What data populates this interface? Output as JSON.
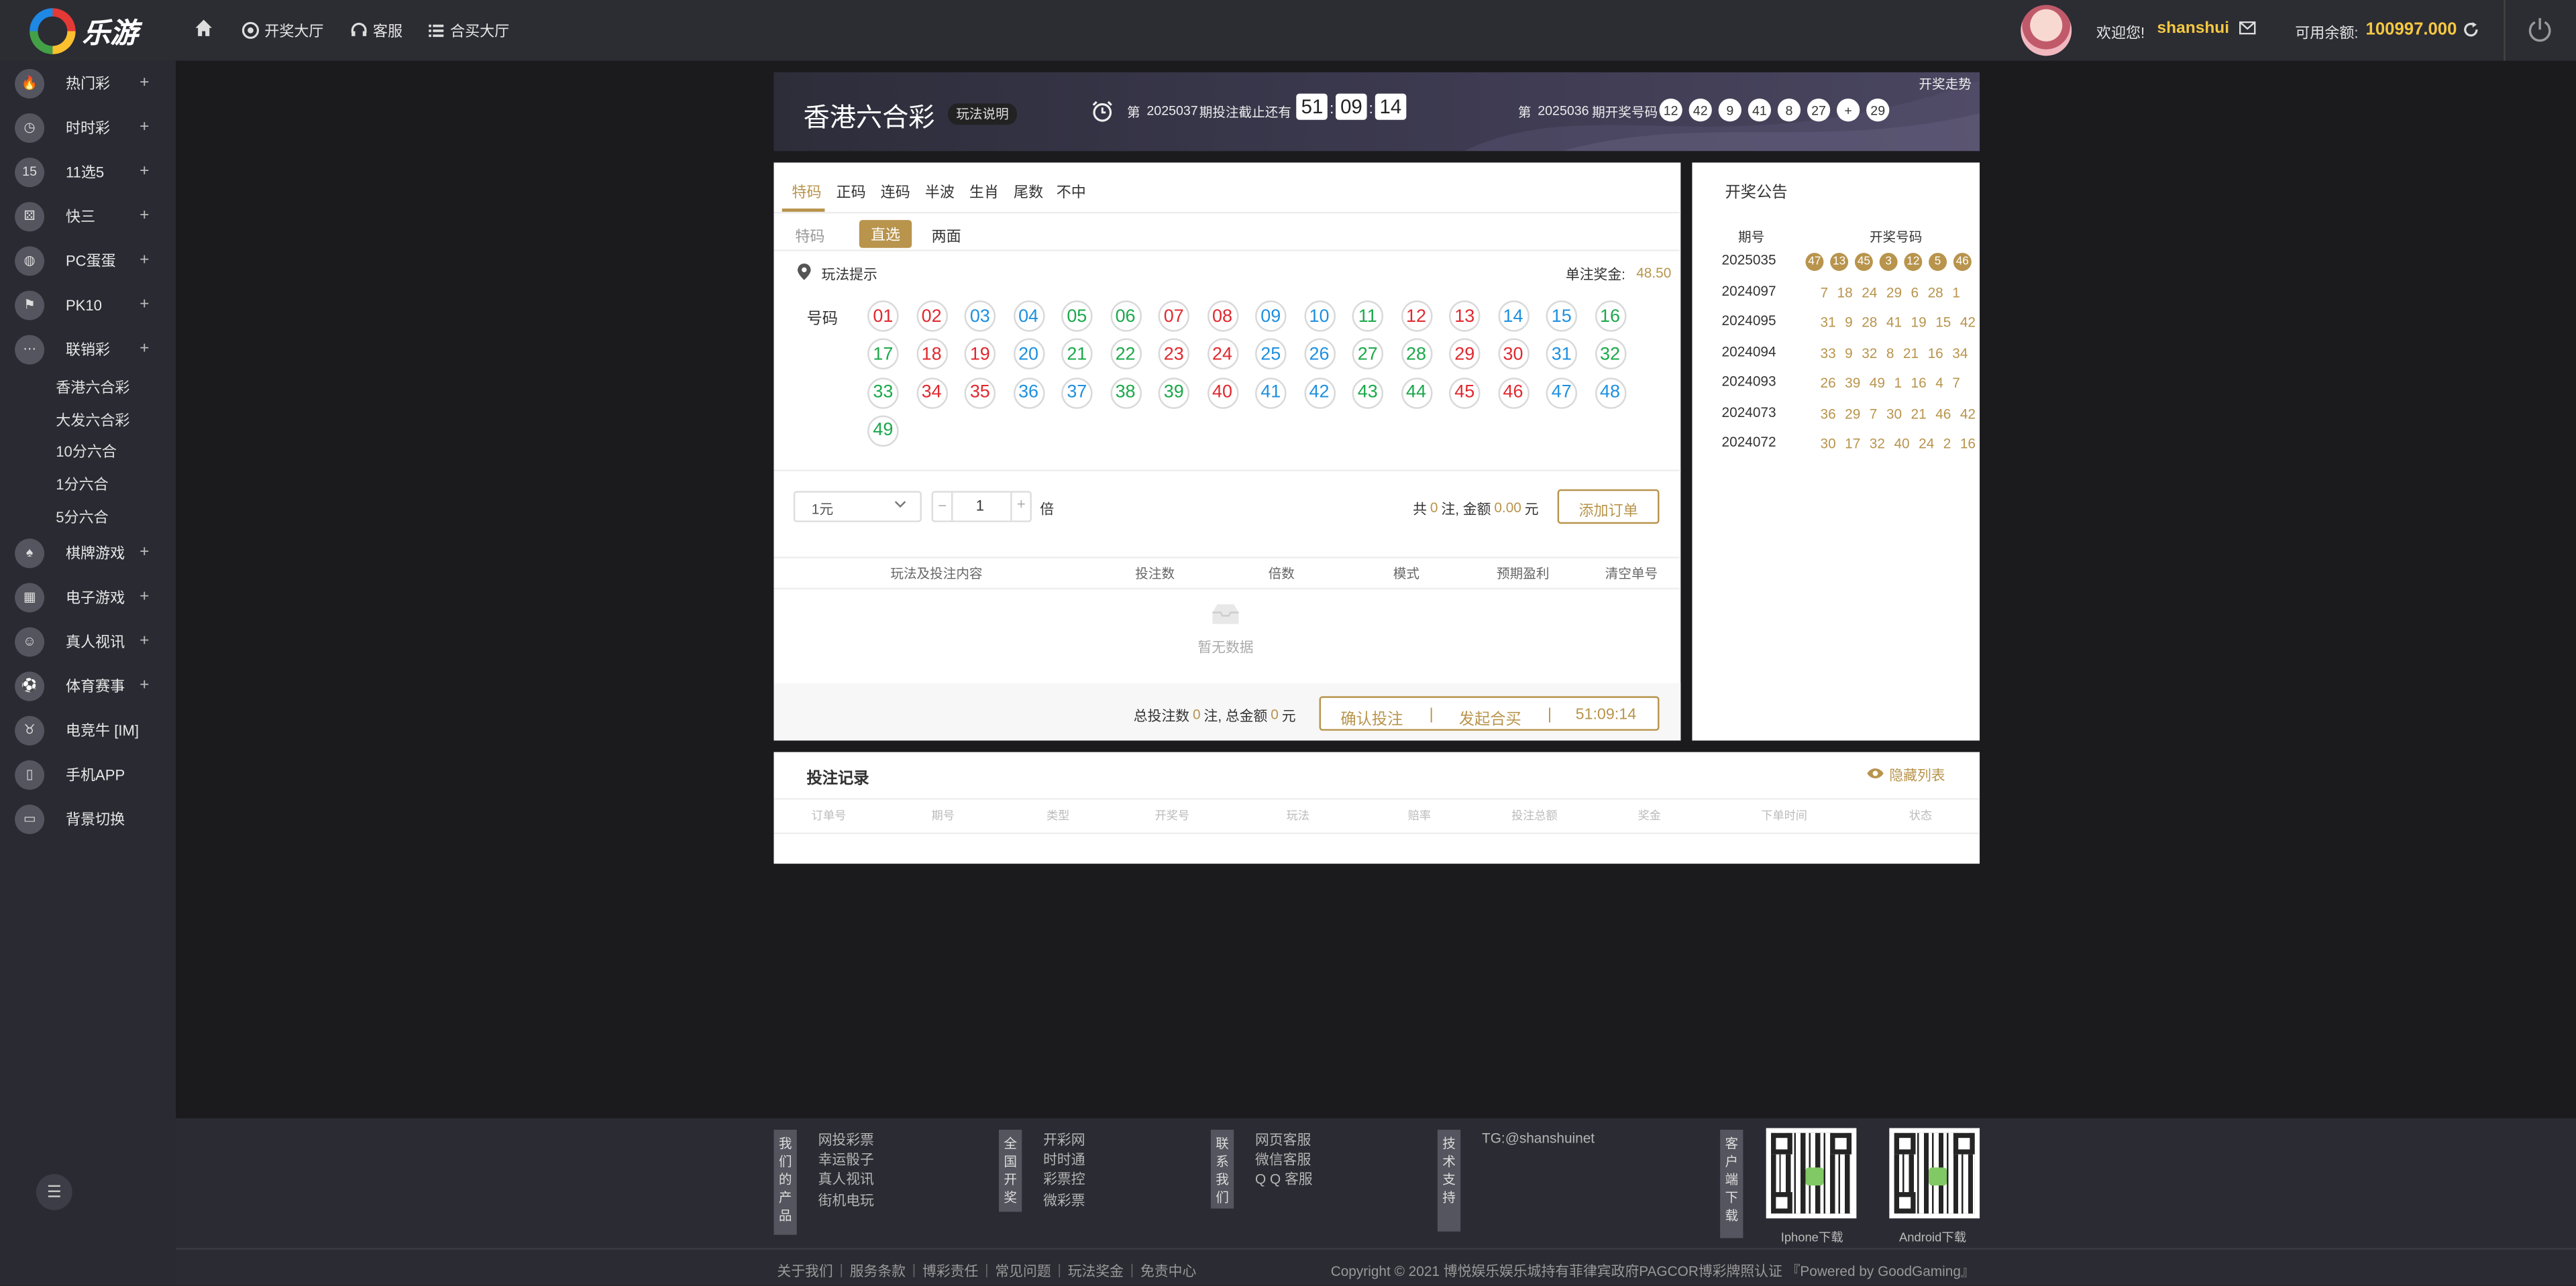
{
  "topbar": {
    "logo_text": "乐游",
    "nav": [
      {
        "label": "开奖大厅",
        "icon": "award-icon"
      },
      {
        "label": "客服",
        "icon": "headset-icon"
      },
      {
        "label": "合买大厅",
        "icon": "list-icon"
      }
    ],
    "welcome": "欢迎您!",
    "username": "shanshui",
    "balance_label": "可用余额:",
    "balance": "100997.000"
  },
  "sidebar": {
    "items": [
      {
        "label": "热门彩",
        "icon": "fire-icon"
      },
      {
        "label": "时时彩",
        "icon": "clock-icon"
      },
      {
        "label": "11选5",
        "icon": "eleven-five-icon"
      },
      {
        "label": "快三",
        "icon": "dice-icon"
      },
      {
        "label": "PC蛋蛋",
        "icon": "egg-icon"
      },
      {
        "label": "PK10",
        "icon": "race-icon"
      },
      {
        "label": "联销彩",
        "icon": "more-icon"
      }
    ],
    "subitems": [
      "香港六合彩",
      "大发六合彩",
      "10分六合",
      "1分六合",
      "5分六合"
    ],
    "items2": [
      {
        "label": "棋牌游戏",
        "icon": "cards-icon",
        "plus": true
      },
      {
        "label": "电子游戏",
        "icon": "slot-icon",
        "plus": true
      },
      {
        "label": "真人视讯",
        "icon": "dealer-icon",
        "plus": true
      },
      {
        "label": "体育赛事",
        "icon": "ball-icon",
        "plus": true
      },
      {
        "label": "电竞牛 [IM]",
        "icon": "bull-icon",
        "plus": false
      },
      {
        "label": "手机APP",
        "icon": "phone-icon",
        "plus": false
      },
      {
        "label": "背景切换",
        "icon": "monitor-icon",
        "plus": false
      }
    ]
  },
  "banner": {
    "title": "香港六合彩",
    "rules_btn": "玩法说明",
    "trend_link": "开奖走势",
    "cur_prefix": "第",
    "cur_period": "2025037",
    "cur_suffix": "期投注截止还有",
    "timer": [
      "51",
      "09",
      "14"
    ],
    "last_prefix": "第",
    "last_period": "2025036",
    "last_suffix": "期开奖号码",
    "last_numbers": [
      "12",
      "42",
      "9",
      "41",
      "8",
      "27",
      "+",
      "29"
    ]
  },
  "bet": {
    "tabs": [
      "特码",
      "正码",
      "连码",
      "半波",
      "生肖",
      "尾数",
      "不中"
    ],
    "subtabs": [
      "特码",
      "直选",
      "两面"
    ],
    "hint": "玩法提示",
    "prize_label": "单注奖金:",
    "prize": "48.50",
    "number_label": "号码",
    "numbers": [
      {
        "n": "01",
        "c": "red"
      },
      {
        "n": "02",
        "c": "red"
      },
      {
        "n": "03",
        "c": "blue"
      },
      {
        "n": "04",
        "c": "blue"
      },
      {
        "n": "05",
        "c": "green"
      },
      {
        "n": "06",
        "c": "green"
      },
      {
        "n": "07",
        "c": "red"
      },
      {
        "n": "08",
        "c": "red"
      },
      {
        "n": "09",
        "c": "blue"
      },
      {
        "n": "10",
        "c": "blue"
      },
      {
        "n": "11",
        "c": "green"
      },
      {
        "n": "12",
        "c": "red"
      },
      {
        "n": "13",
        "c": "red"
      },
      {
        "n": "14",
        "c": "blue"
      },
      {
        "n": "15",
        "c": "blue"
      },
      {
        "n": "16",
        "c": "green"
      },
      {
        "n": "17",
        "c": "green"
      },
      {
        "n": "18",
        "c": "red"
      },
      {
        "n": "19",
        "c": "red"
      },
      {
        "n": "20",
        "c": "blue"
      },
      {
        "n": "21",
        "c": "green"
      },
      {
        "n": "22",
        "c": "green"
      },
      {
        "n": "23",
        "c": "red"
      },
      {
        "n": "24",
        "c": "red"
      },
      {
        "n": "25",
        "c": "blue"
      },
      {
        "n": "26",
        "c": "blue"
      },
      {
        "n": "27",
        "c": "green"
      },
      {
        "n": "28",
        "c": "green"
      },
      {
        "n": "29",
        "c": "red"
      },
      {
        "n": "30",
        "c": "red"
      },
      {
        "n": "31",
        "c": "blue"
      },
      {
        "n": "32",
        "c": "green"
      },
      {
        "n": "33",
        "c": "green"
      },
      {
        "n": "34",
        "c": "red"
      },
      {
        "n": "35",
        "c": "red"
      },
      {
        "n": "36",
        "c": "blue"
      },
      {
        "n": "37",
        "c": "blue"
      },
      {
        "n": "38",
        "c": "green"
      },
      {
        "n": "39",
        "c": "green"
      },
      {
        "n": "40",
        "c": "red"
      },
      {
        "n": "41",
        "c": "blue"
      },
      {
        "n": "42",
        "c": "blue"
      },
      {
        "n": "43",
        "c": "green"
      },
      {
        "n": "44",
        "c": "green"
      },
      {
        "n": "45",
        "c": "red"
      },
      {
        "n": "46",
        "c": "red"
      },
      {
        "n": "47",
        "c": "blue"
      },
      {
        "n": "48",
        "c": "blue"
      },
      {
        "n": "49",
        "c": "green"
      }
    ],
    "unit": "1元",
    "multiplier": "1",
    "times_label": "倍",
    "summary": {
      "pre": "共",
      "bets": "0",
      "mid": "注, 金额",
      "amount": "0.00",
      "post": "元"
    },
    "add_btn": "添加订单",
    "columns": [
      "玩法及投注内容",
      "投注数",
      "倍数",
      "模式",
      "预期盈利",
      "清空单号"
    ],
    "empty": "暂无数据",
    "footer": {
      "pre": "总投注数",
      "bets": "0",
      "mid": "注, 总金额",
      "amount": "0",
      "post": "元"
    },
    "confirm": "确认投注",
    "group": "发起合买",
    "timer": "51:09:14"
  },
  "records": {
    "title": "投注记录",
    "hide": "隐藏列表",
    "columns": [
      "订单号",
      "期号",
      "类型",
      "开奖号",
      "玩法",
      "赔率",
      "投注总额",
      "奖金",
      "下单时间",
      "状态"
    ]
  },
  "notice": {
    "title": "开奖公告",
    "col_period": "期号",
    "col_numbers": "开奖号码",
    "rows": [
      {
        "p": "2025035",
        "n": [
          "47",
          "13",
          "45",
          "3",
          "12",
          "5",
          "46"
        ],
        "ball": true
      },
      {
        "p": "2024097",
        "n": [
          "7",
          "18",
          "24",
          "29",
          "6",
          "28",
          "1"
        ]
      },
      {
        "p": "2024095",
        "n": [
          "31",
          "9",
          "28",
          "41",
          "19",
          "15",
          "42"
        ]
      },
      {
        "p": "2024094",
        "n": [
          "33",
          "9",
          "32",
          "8",
          "21",
          "16",
          "34"
        ]
      },
      {
        "p": "2024093",
        "n": [
          "26",
          "39",
          "49",
          "1",
          "16",
          "4",
          "7"
        ]
      },
      {
        "p": "2024073",
        "n": [
          "36",
          "29",
          "7",
          "30",
          "21",
          "46",
          "42"
        ]
      },
      {
        "p": "2024072",
        "n": [
          "30",
          "17",
          "32",
          "40",
          "24",
          "2",
          "16"
        ]
      }
    ]
  },
  "footer": {
    "groups": [
      {
        "tag": "我们的产品",
        "links": [
          "网投彩票",
          "幸运骰子",
          "真人视讯",
          "街机电玩"
        ]
      },
      {
        "tag": "全国开奖",
        "links": [
          "开彩网",
          "时时通",
          "彩票控",
          "微彩票"
        ]
      },
      {
        "tag": "联系我们",
        "links": [
          "网页客服",
          "微信客服",
          "Q Q 客服"
        ]
      },
      {
        "tag": "技术支持",
        "links": [
          "TG:@shanshuinet"
        ]
      },
      {
        "tag": "客户端下载",
        "links": []
      }
    ],
    "qr": [
      "Iphone下载",
      "Android下载"
    ],
    "bottom_links": [
      "关于我们",
      "服务条款",
      "博彩责任",
      "常见问题",
      "玩法奖金",
      "免责中心"
    ],
    "copyright": "Copyright © 2021 博悦娱乐娱乐城持有菲律宾政府PAGCOR博彩牌照认证 『Powered by GoodGaming』"
  },
  "colors": {
    "gold": "#b8944c",
    "red": "#e0282e",
    "blue": "#1d8fe0",
    "green": "#1aa84a",
    "balance": "#f5c842"
  }
}
